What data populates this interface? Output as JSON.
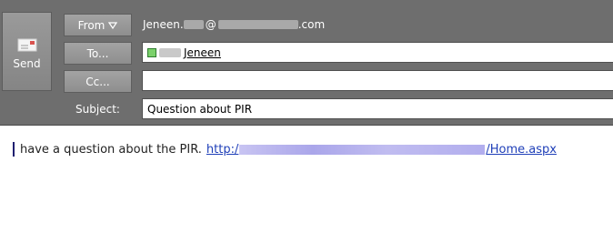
{
  "compose": {
    "send_label": "Send",
    "from_label": "From",
    "to_label": "To...",
    "cc_label": "Cc...",
    "subject_label": "Subject:",
    "from_name": "Jeneen.",
    "from_at": "@",
    "from_domain_suffix": ".com",
    "to_recipient": "Jeneen",
    "cc_value": "",
    "subject_value": "Question about PIR",
    "body_text": "have a question about the PIR.",
    "link_prefix": "http:/",
    "link_suffix": "/Home.aspx"
  },
  "colors": {
    "header_bg": "#6e6e6e",
    "link": "#1f3fb8",
    "contact_green": "#7bd16b"
  },
  "icons": {
    "send": "envelope-icon",
    "from_dropdown": "triangle-down-icon",
    "contact": "contact-status-icon"
  }
}
